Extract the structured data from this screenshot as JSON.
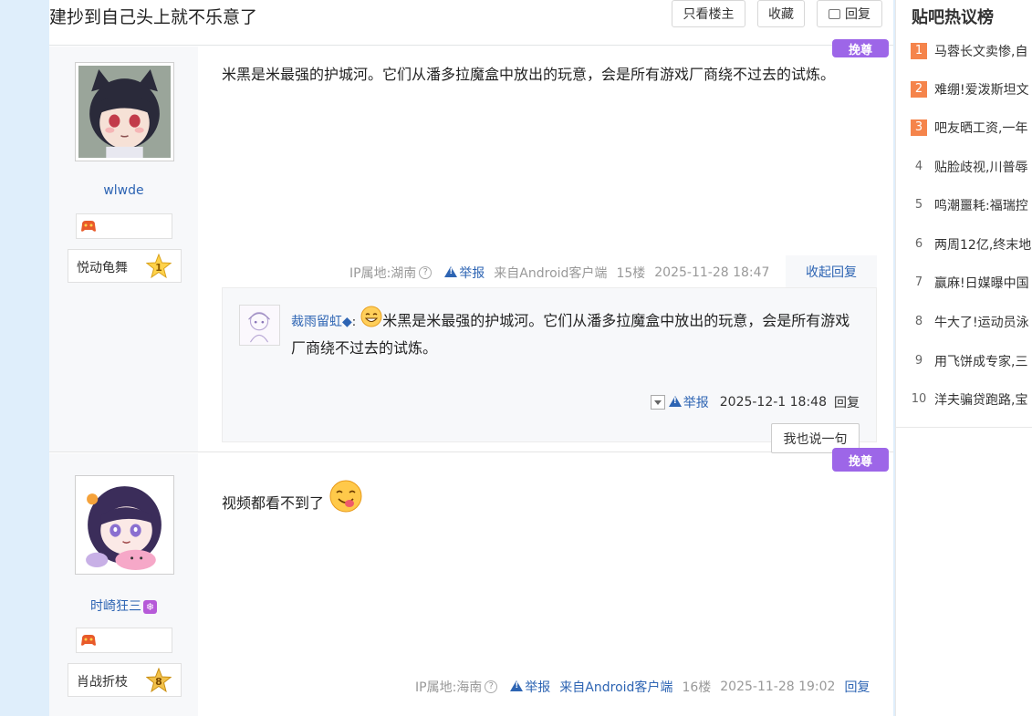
{
  "thread": {
    "title": "建抄到自己头上就不乐意了",
    "btn_only_op": "只看楼主",
    "btn_favorite": "收藏",
    "btn_reply": "回复"
  },
  "posts": [
    {
      "username": "wlwde",
      "level_name": "悦动龟舞",
      "level_num": "1",
      "content": "米黑是米最强的护城河。它们从潘多拉魔盒中放出的玩意，会是所有游戏厂商绕不过去的试炼。",
      "ip": "IP属地:湖南",
      "report": "举报",
      "client": "来自Android客户端",
      "floor": "15楼",
      "time": "2025-11-28 18:47",
      "fold_label": "收起回复",
      "save_tag": "挽尊",
      "subreply": {
        "name": "裁雨留虹◆",
        "colon": ":",
        "text": "米黑是米最强的护城河。它们从潘多拉魔盒中放出的玩意，会是所有游戏厂商绕不过去的试炼。",
        "report": "举报",
        "time": "2025-12-1 18:48",
        "reply": "回复",
        "say_btn": "我也说一句"
      }
    },
    {
      "username": "时崎狂三",
      "level_name": "肖战折枝",
      "level_num": "8",
      "content": "视频都看不到了",
      "ip": "IP属地:海南",
      "report": "举报",
      "client": "来自Android客户端",
      "floor": "16楼",
      "time": "2025-11-28 19:02",
      "reply": "回复",
      "save_tag": "挽尊"
    }
  ],
  "sidebar": {
    "title": "贴吧热议榜",
    "items": [
      {
        "num": "1",
        "text": "马蓉长文卖惨,自"
      },
      {
        "num": "2",
        "text": "难绷!爱泼斯坦文"
      },
      {
        "num": "3",
        "text": "吧友晒工资,一年"
      },
      {
        "num": "4",
        "text": "贴脸歧视,川普辱"
      },
      {
        "num": "5",
        "text": "鸣潮噩耗:福瑞控"
      },
      {
        "num": "6",
        "text": "两周12亿,终末地"
      },
      {
        "num": "7",
        "text": "赢麻!日媒曝中国"
      },
      {
        "num": "8",
        "text": "牛大了!运动员泳"
      },
      {
        "num": "9",
        "text": "用飞饼成专家,三"
      },
      {
        "num": "10",
        "text": "洋夫骗贷跑路,宝"
      }
    ]
  },
  "colors": {
    "link": "#2d64b3",
    "accent_top3": "#f5844b",
    "save_tag": "#9d66e8",
    "page_bg": "#dfeefb"
  }
}
